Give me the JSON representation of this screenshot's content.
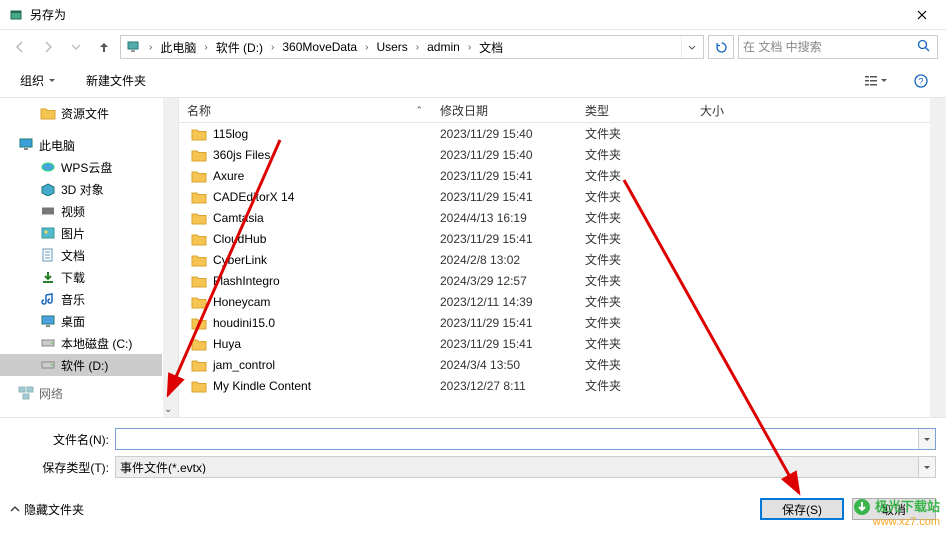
{
  "window": {
    "title": "另存为"
  },
  "breadcrumb": {
    "segs": [
      "此电脑",
      "软件 (D:)",
      "360MoveData",
      "Users",
      "admin",
      "文档"
    ]
  },
  "search": {
    "placeholder": "在 文档 中搜索"
  },
  "toolbar": {
    "organize": "组织",
    "newfolder": "新建文件夹"
  },
  "sidebar": {
    "resources": "资源文件",
    "thispc": "此电脑",
    "items": [
      {
        "label": "WPS云盘",
        "icon": "wps"
      },
      {
        "label": "3D 对象",
        "icon": "3d"
      },
      {
        "label": "视频",
        "icon": "video"
      },
      {
        "label": "图片",
        "icon": "pic"
      },
      {
        "label": "文档",
        "icon": "doc"
      },
      {
        "label": "下载",
        "icon": "dl"
      },
      {
        "label": "音乐",
        "icon": "music"
      },
      {
        "label": "桌面",
        "icon": "desk"
      },
      {
        "label": "本地磁盘 (C:)",
        "icon": "disk"
      },
      {
        "label": "软件 (D:)",
        "icon": "disk",
        "selected": true
      }
    ],
    "network": "网络"
  },
  "columns": {
    "name": "名称",
    "date": "修改日期",
    "type": "类型",
    "size": "大小"
  },
  "files": [
    {
      "name": "115log",
      "date": "2023/11/29 15:40",
      "type": "文件夹"
    },
    {
      "name": "360js Files",
      "date": "2023/11/29 15:40",
      "type": "文件夹"
    },
    {
      "name": "Axure",
      "date": "2023/11/29 15:41",
      "type": "文件夹"
    },
    {
      "name": "CADEditorX 14",
      "date": "2023/11/29 15:41",
      "type": "文件夹"
    },
    {
      "name": "Camtasia",
      "date": "2024/4/13 16:19",
      "type": "文件夹"
    },
    {
      "name": "CloudHub",
      "date": "2023/11/29 15:41",
      "type": "文件夹"
    },
    {
      "name": "CyberLink",
      "date": "2024/2/8 13:02",
      "type": "文件夹"
    },
    {
      "name": "FlashIntegro",
      "date": "2024/3/29 12:57",
      "type": "文件夹"
    },
    {
      "name": "Honeycam",
      "date": "2023/12/11 14:39",
      "type": "文件夹"
    },
    {
      "name": "houdini15.0",
      "date": "2023/11/29 15:41",
      "type": "文件夹"
    },
    {
      "name": "Huya",
      "date": "2023/11/29 15:41",
      "type": "文件夹"
    },
    {
      "name": "jam_control",
      "date": "2024/3/4 13:50",
      "type": "文件夹"
    },
    {
      "name": "My Kindle Content",
      "date": "2023/12/27 8:11",
      "type": "文件夹"
    }
  ],
  "fields": {
    "filename_label": "文件名(N):",
    "filename_value": "",
    "filetype_label": "保存类型(T):",
    "filetype_value": "事件文件(*.evtx)"
  },
  "footer": {
    "hide": "隐藏文件夹",
    "save": "保存(S)",
    "cancel": "取消"
  },
  "watermark": {
    "line1": "极光下载站",
    "line2": "www.xz7.com"
  }
}
